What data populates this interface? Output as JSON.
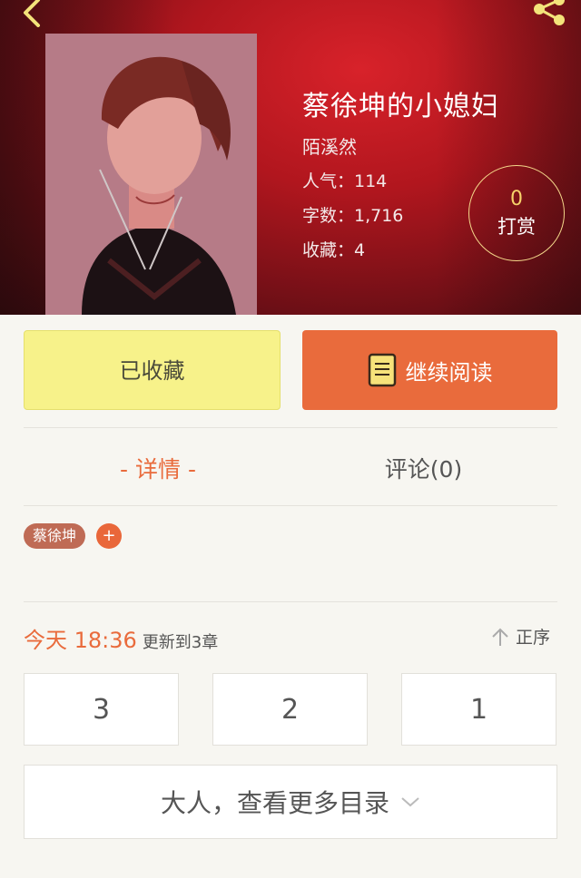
{
  "book": {
    "title": "蔡徐坤的小媳妇",
    "author": "陌溪然",
    "popularity": "人气：114",
    "word_count": "字数：1,716",
    "favorites": "收藏：4"
  },
  "tip": {
    "count": "0",
    "label": "打赏"
  },
  "actions": {
    "collected_label": "已收藏",
    "read_label": "继续阅读"
  },
  "tabs": {
    "detail": "- 详情 -",
    "comments": "评论(0)"
  },
  "tags": {
    "items": [
      "蔡徐坤"
    ],
    "add": "+"
  },
  "updates": {
    "time": "今天 18:36",
    "text": "更新到3章",
    "sort": "正序"
  },
  "chapters": [
    "3",
    "2",
    "1"
  ],
  "more": {
    "label": "大人，查看更多目录"
  },
  "colors": {
    "accent": "#e96b3c",
    "collected_bg": "#f7f28a",
    "hero_red": "#b1161e",
    "tag_bg": "#bf6b55"
  },
  "icons": [
    "back-arrow-icon",
    "share-icon",
    "book-icon",
    "up-arrow-icon",
    "chevron-down-icon"
  ]
}
